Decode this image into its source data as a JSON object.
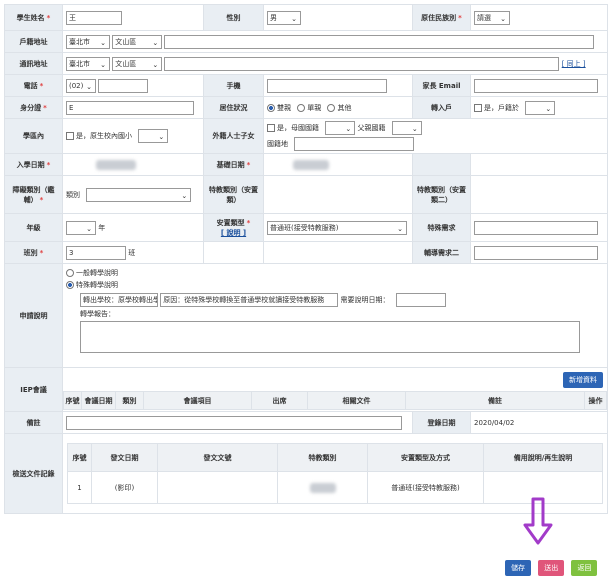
{
  "fields": {
    "name_label": "學生姓名",
    "name_value": "王",
    "gender_label": "性別",
    "gender_value": "男",
    "nationality_label": "原住民族別",
    "nationality_value": "請選",
    "household_addr_label": "戶籍地址",
    "household_city": "臺北市",
    "household_dist": "文山區",
    "mail_addr_label": "通訊地址",
    "mail_city": "臺北市",
    "mail_dist": "文山區",
    "same_link": "[ 同上 ]",
    "phone_label": "電話",
    "phone_code": "(02)",
    "mobile_label": "手機",
    "email_label": "家長 Email",
    "id_label": "身分證",
    "id_value": "E",
    "residence_label": "居住狀況",
    "res_opt1": "雙親",
    "res_opt2": "單親",
    "res_opt3": "其他",
    "transfer_label": "轉入戶",
    "transfer_opt": "是，戶籍於",
    "district_label": "學區內",
    "district_opt": "是，原生校內國小",
    "foreign_label": "外籍人士子女",
    "foreign_opt": "是，母國國籍",
    "foreign_opt2": "父親國籍",
    "foreign_addr": "國籍地",
    "entry_date_label": "入學日期",
    "basic_date_label": "基礎日期",
    "disability_type_label": "障礙類別（鑑輔）",
    "disability_sub": "類別",
    "special_type_label": "特教類別（安置類）",
    "special_type2_label": "特教類別（安置類二）",
    "grade_label": "年級",
    "grade_unit": "年",
    "placement_label": "安置類型",
    "placement_help": "[ 說明 ]",
    "placement_value": "普通班(接受特教服務)",
    "assist_label": "特殊需求",
    "class_label": "班別",
    "class_value": "3",
    "class_unit": "班",
    "assist2_label": "輔導需求二",
    "apply_label": "申請說明",
    "apply_opt1": "一般轉學說明",
    "apply_opt2": "特殊轉學說明",
    "apply_from": "轉出學校：原學校轉出學校",
    "apply_reason": "原因：從特殊學校轉換至普通學校就讀接受特教服務",
    "apply_date": "需要說明日期：",
    "apply_note": "轉學報告：",
    "meeting_label": "IEP會議",
    "add_row_btn": "新增資料",
    "meeting_cols": [
      "序號",
      "會議日期",
      "類別",
      "會議項目",
      "出席",
      "相關文件",
      "備註",
      "操作"
    ],
    "note_label": "備註",
    "record_date_label": "登錄日期",
    "record_date_value": "2020/04/02",
    "doc_label": "檢送文件記錄",
    "doc_cols": [
      "序號",
      "發文日期",
      "發文文號",
      "特教類別",
      "安置類型及方式",
      "備用說明/再生說明"
    ],
    "doc_row": [
      "1",
      "(影印)",
      "",
      "",
      "普通班(接受特教服務)",
      ""
    ]
  },
  "buttons": {
    "save": "儲存",
    "submit": "送出",
    "back": "返回"
  },
  "colors": {
    "accent": "#2d65b5",
    "submit": "#e0557a",
    "back": "#7fc13f",
    "arrow": "#a23bc9"
  }
}
